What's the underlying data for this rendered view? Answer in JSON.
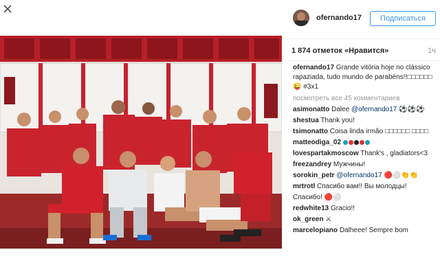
{
  "close_icon": "close-x-icon",
  "photo_icon": "team-photo",
  "post": {
    "username": "ofernando17",
    "follow_label": "Подписаться",
    "likes": "1 874 отметок «Нравится»",
    "time": "1ч",
    "caption": {
      "user": "ofernando17",
      "text": "Grande vitória hoje no clássico rapaziada, tudo mundo de parabéns!!□□□□□□😜 #3x1"
    },
    "more_comments": "посмотреть все 45 комментариев",
    "comments": [
      {
        "user": "asimonatto",
        "text": "Dalee",
        "mention": "@ofernando17",
        "suffix": "⚽⚽⚽"
      },
      {
        "user": "shestua",
        "text": "Thank you!"
      },
      {
        "user": "tsimonatto",
        "text": "Coisa linda irmão □□□□□□ □□□□"
      },
      {
        "user": "matteodiga_02",
        "text": "",
        "dots": [
          "#17a2b8",
          "#e03030",
          "#222222",
          "#e03030",
          "#17a2b8"
        ]
      },
      {
        "user": "lovespartakmoscow",
        "text": "Thank's , gladiators<3"
      },
      {
        "user": "freezandrey",
        "text": "Мужчины!"
      },
      {
        "user": "sorokin_petr",
        "text": "",
        "mention": "@ofernando17",
        "suffix": "🔴⚪👏👏"
      },
      {
        "user": "mrtrotl",
        "text": "Спасибо вам!! Вы молодцы! Спасибо! 🔴⚪"
      },
      {
        "user": "redwhite13",
        "text": "Gracio!!"
      },
      {
        "user": "ok_green",
        "text": "⚔"
      },
      {
        "user": "marcelopiano",
        "text": "Dalheee! Sempre bom"
      }
    ]
  },
  "colors": {
    "accent": "#3897f0",
    "mention": "#003569",
    "muted": "#999999",
    "divider": "#efefef",
    "spartak_red": "#d91e2a"
  }
}
